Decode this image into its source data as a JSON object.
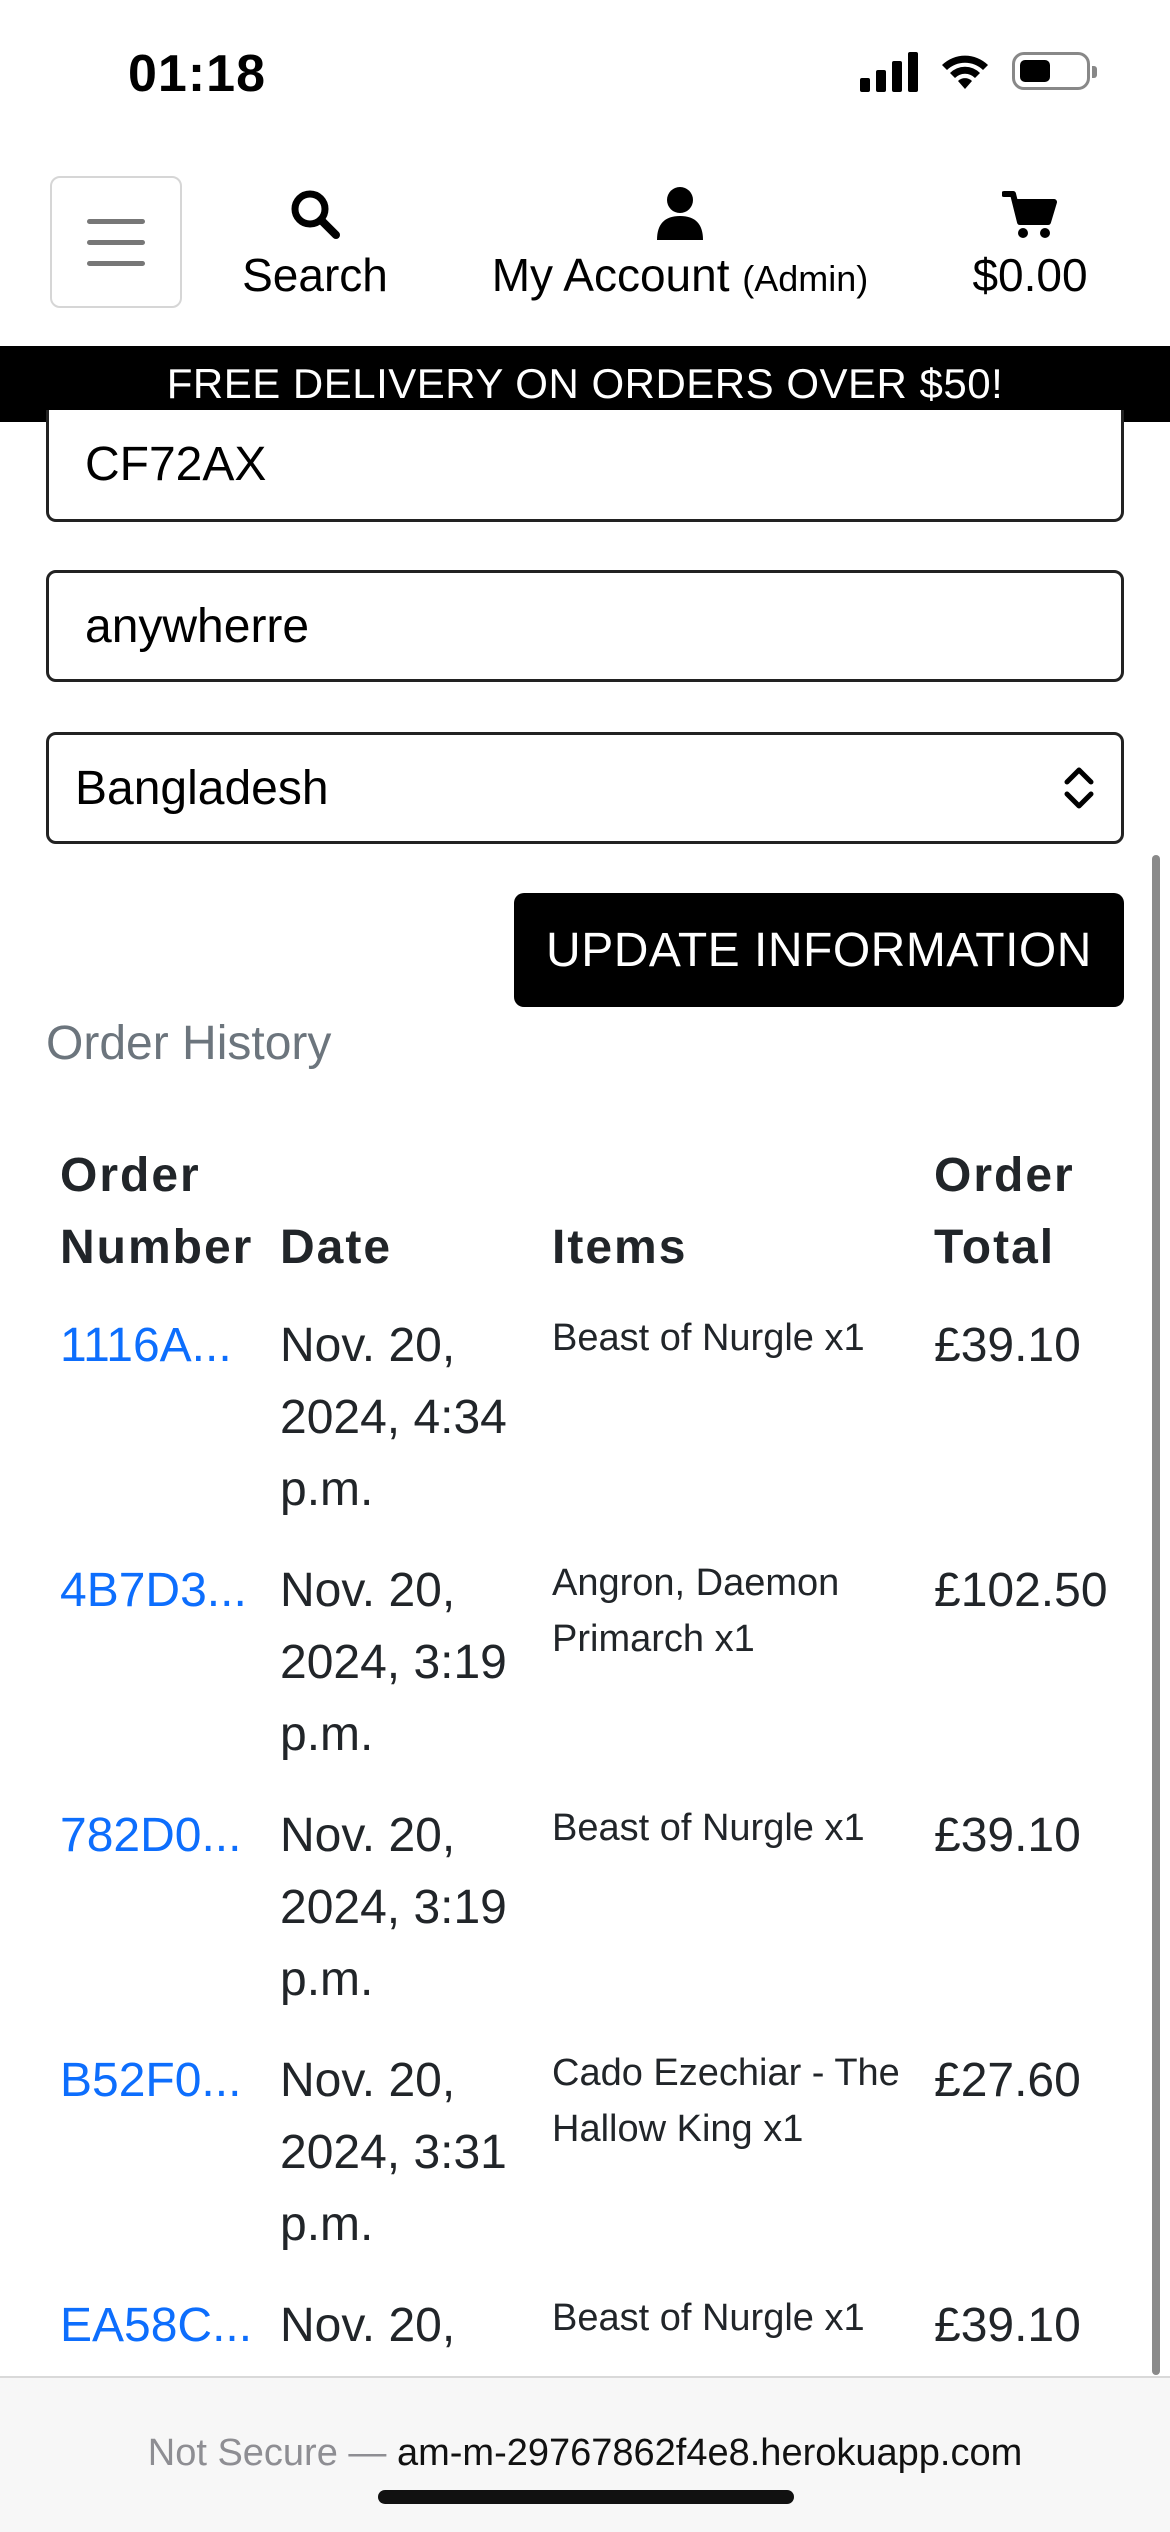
{
  "status_bar": {
    "time": "01:18",
    "icons": [
      "signal-icon",
      "wifi-icon",
      "battery-icon"
    ]
  },
  "header": {
    "menu_icon": "hamburger-menu-icon",
    "search": {
      "icon": "search-icon",
      "label": "Search"
    },
    "account": {
      "icon": "user-icon",
      "label": "My Account",
      "sub_label": "(Admin)"
    },
    "cart": {
      "icon": "cart-icon",
      "label": "$0.00"
    }
  },
  "banner": {
    "text": "FREE DELIVERY ON ORDERS OVER $50!"
  },
  "form": {
    "postcode_value": "CF72AX",
    "county_value": "anywherre",
    "country_selected": "Bangladesh",
    "update_button": "UPDATE INFORMATION"
  },
  "order_history": {
    "title": "Order History",
    "headers": {
      "order_number_1": "Order",
      "order_number_2": "Number",
      "date": "Date",
      "items": "Items",
      "total_1": "Order",
      "total_2": "Total"
    },
    "rows": [
      {
        "number": "1116A...",
        "date": "Nov. 20, 2024, 4:34 p.m.",
        "items": "Beast of Nurgle x1",
        "total": "£39.10"
      },
      {
        "number": "4B7D3...",
        "date": "Nov. 20, 2024, 3:19 p.m.",
        "items": "Angron, Daemon Primarch x1",
        "total": "£102.50"
      },
      {
        "number": "782D0...",
        "date": "Nov. 20, 2024, 3:19 p.m.",
        "items": "Beast of Nurgle x1",
        "total": "£39.10"
      },
      {
        "number": "B52F0...",
        "date": "Nov. 20, 2024, 3:31 p.m.",
        "items": "Cado Ezechiar - The Hallow King x1",
        "total": "£27.60"
      },
      {
        "number": "EA58C...",
        "date": "Nov. 20,",
        "items": "Beast of Nurgle x1",
        "total": "£39.10"
      }
    ]
  },
  "browser": {
    "security_label": "Not Secure —",
    "url": "am-m-29767862f4e8.herokuapp.com"
  },
  "colors": {
    "link": "#0d6efd",
    "muted": "#6c757d",
    "banner_bg": "#000000",
    "button_bg": "#000000"
  }
}
